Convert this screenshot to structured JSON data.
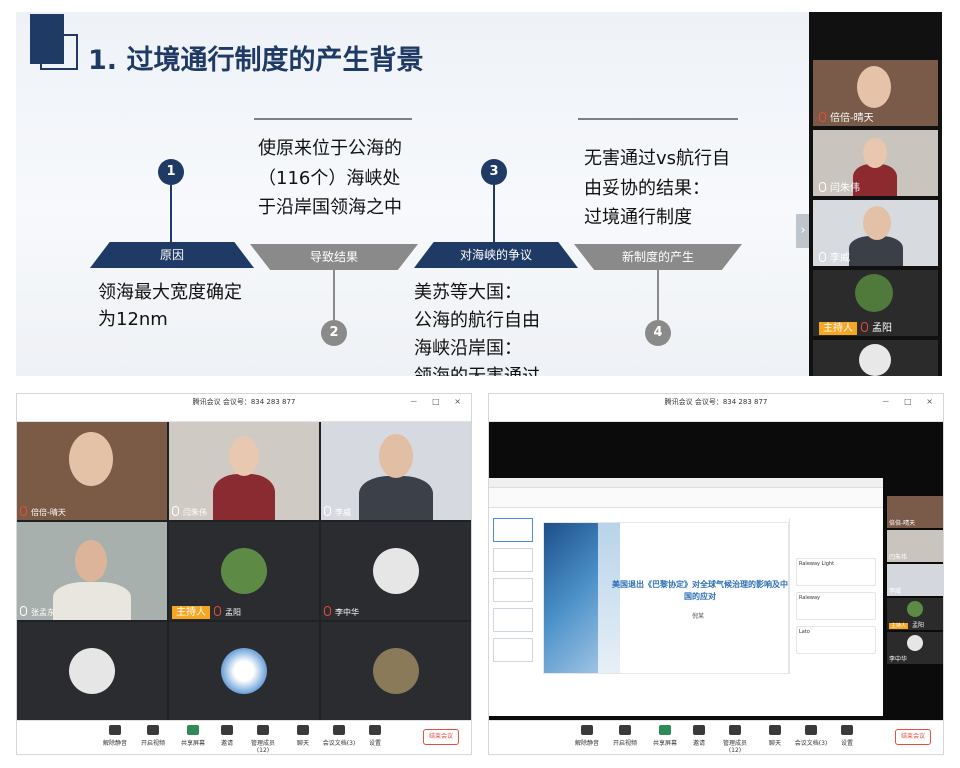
{
  "slide": {
    "title": "1. 过境通行制度的产生背景",
    "steps": [
      {
        "num": "1",
        "label": "原因"
      },
      {
        "num": "2",
        "label": "导致结果"
      },
      {
        "num": "3",
        "label": "对海峡的争议"
      },
      {
        "num": "4",
        "label": "新制度的产生"
      }
    ],
    "texts": {
      "t2a": "使原来位于公海的",
      "t2b": "（116个）海峡处",
      "t2c": "于沿岸国领海之中",
      "t4a": "无害通过vs航行自",
      "t4b": "由妥协的结果：",
      "t4c": "过境通行制度",
      "t1a": "领海最大宽度确定",
      "t1b": "为12nm",
      "t3a": "美苏等大国：",
      "t3b": " 公海的航行自由",
      "t3c": "海峡沿岸国：",
      "t3d": " 领海的无害通过"
    },
    "next_arrow": "›"
  },
  "side": {
    "participants": [
      "倍倍-晴天",
      "闫朱伟",
      "李威",
      "孟阳",
      ""
    ],
    "host_badge": "主持人"
  },
  "meeting": {
    "title": "腾讯会议  会议号：834 283 877",
    "window_controls": "－ □ ×",
    "tiles": [
      {
        "name": "倍倍-晴天"
      },
      {
        "name": "闫朱伟"
      },
      {
        "name": "李威"
      },
      {
        "name": "张孟东"
      },
      {
        "name": "孟阳",
        "host": "主持人"
      },
      {
        "name": "李中华"
      },
      {
        "name": ""
      },
      {
        "name": ""
      },
      {
        "name": ""
      }
    ],
    "toolbar": {
      "mute": "解除静音",
      "video": "开启视频",
      "share": "共享屏幕",
      "invite": "邀请",
      "members": "管理成员(12)",
      "chat": "聊天",
      "docs": "会议文档(3)",
      "settings": "设置",
      "end": "结束会议"
    }
  },
  "meeting_right": {
    "title": "腾讯会议  会议号：834 283 877",
    "window_controls": "－ □ ×",
    "ppt_title": "美国退出《巴黎协定》对全球气候治理的影响及中国的应对",
    "ppt_author": "倪某",
    "pane_fonts": [
      "Raleway Light",
      "Raleway",
      "Lato"
    ],
    "side": [
      "倍倍-晴天",
      "闫朱伟",
      "李威",
      "孟阳",
      "李中华"
    ],
    "host_badge": "主持人",
    "toolbar": {
      "mute": "解除静音",
      "video": "开启视频",
      "share": "共享屏幕",
      "invite": "邀请",
      "members": "管理成员(12)",
      "chat": "聊天",
      "docs": "会议文档(3)",
      "settings": "设置",
      "end": "结束会议"
    }
  },
  "colors": {
    "navy": "#1f3a64",
    "gray": "#8a8a8a",
    "host": "#f5a623",
    "end": "#e74c3c"
  }
}
